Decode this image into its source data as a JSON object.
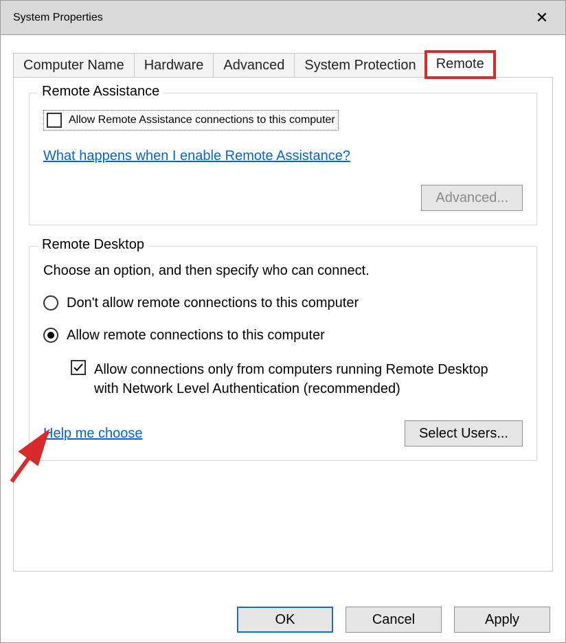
{
  "window": {
    "title": "System Properties",
    "close_label": "✕"
  },
  "tabs": {
    "items": [
      "Computer Name",
      "Hardware",
      "Advanced",
      "System Protection",
      "Remote"
    ],
    "active_index": 4
  },
  "remote_assistance": {
    "legend": "Remote Assistance",
    "allow_label": "Allow Remote Assistance connections to this computer",
    "allow_checked": false,
    "help_link": "What happens when I enable Remote Assistance?",
    "advanced_button": "Advanced...",
    "advanced_enabled": false
  },
  "remote_desktop": {
    "legend": "Remote Desktop",
    "instruction": "Choose an option, and then specify who can connect.",
    "radio_dont_allow": "Don't allow remote connections to this computer",
    "radio_allow": "Allow remote connections to this computer",
    "selected_radio": "allow",
    "nla_label": "Allow connections only from computers running Remote Desktop with Network Level Authentication (recommended)",
    "nla_checked": true,
    "help_link": "Help me choose",
    "select_users_button": "Select Users..."
  },
  "dialog_buttons": {
    "ok": "OK",
    "cancel": "Cancel",
    "apply": "Apply"
  }
}
